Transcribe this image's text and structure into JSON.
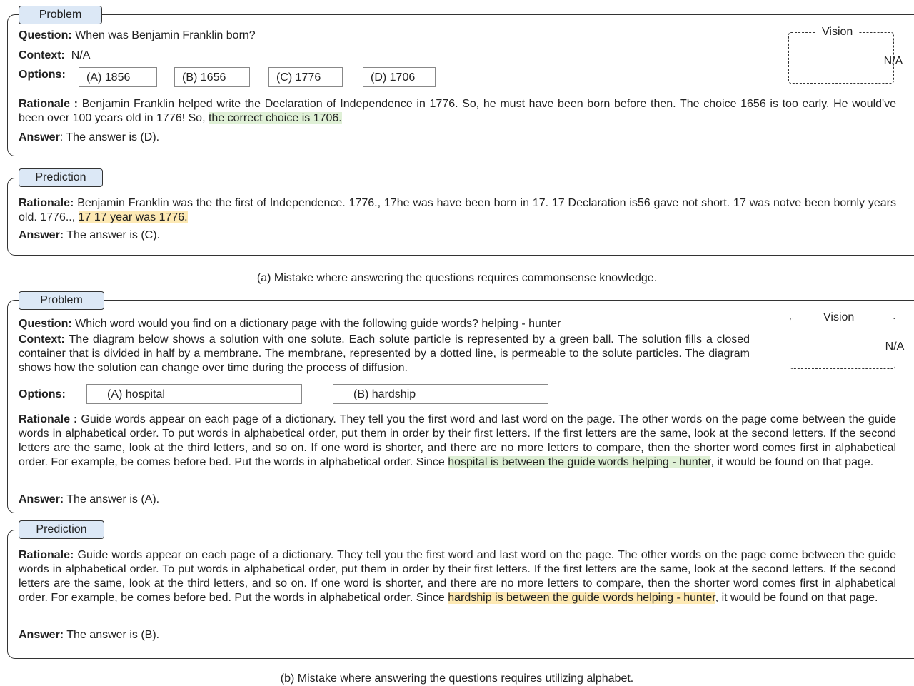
{
  "example_a": {
    "problem_tab": "Problem",
    "question_label": "Question:",
    "question": "When was Benjamin Franklin born?",
    "context_label": "Context:",
    "context": "N/A",
    "options_label": "Options:",
    "options": [
      "(A) 1856",
      "(B) 1656",
      "(C) 1776",
      "(D) 1706"
    ],
    "vision_label": "Vision",
    "vision_value": "N/A",
    "rationale_label": "Rationale :",
    "rationale_text": "Benjamin Franklin helped write the Declaration of Independence in 1776. So, he must have been born before then. The choice 1656 is too early. He would've been over 100 years old in 1776! So,",
    "rationale_highlight": "the correct choice is 1706.",
    "answer_label": "Answer",
    "answer": ":  The answer is (D).",
    "prediction_tab": "Prediction",
    "pred_rationale_label": "Rationale:",
    "pred_rationale_text": "Benjamin Franklin was the the first of Independence. 1776., 17he was have been born in 17. 17 Declaration is56 gave not short. 17 was notve been bornly years old. 1776..,",
    "pred_rationale_highlight": "17 17 year was 1776.",
    "pred_answer_label": "Answer:",
    "pred_answer": "The answer is (C).",
    "caption": "(a) Mistake where answering the questions requires commonsense knowledge."
  },
  "example_b": {
    "problem_tab": "Problem",
    "question_label": "Question:",
    "question": "Which word would you find on a dictionary page with the following guide words? helping - hunter",
    "context_label": "Context:",
    "context": "The diagram below shows a solution with one solute. Each solute particle is represented by a green ball. The solution fills a closed container that is divided in half by a membrane. The membrane, represented by a dotted line, is permeable to the solute particles. The diagram shows how the solution can change over time during the process of diffusion.",
    "options_label": "Options:",
    "options": [
      "(A) hospital",
      "(B) hardship"
    ],
    "vision_label": "Vision",
    "vision_value": "N/A",
    "rationale_label": "Rationale :",
    "rationale_text": "Guide words appear on each page of a dictionary. They tell you the first word and last word on the page. The other words on the page come between the guide words in alphabetical order. To put words in alphabetical order, put them in order by their first letters. If the first letters are the same, look at the second letters. If the second letters are the same, look at the third letters, and so on. If one word is shorter, and there are no more letters to compare, then the shorter word comes first in alphabetical order. For example, be comes before bed. Put the words in alphabetical order. Since",
    "rationale_highlight": "hospital is between the guide words helping - hunter",
    "rationale_tail": ", it would be found on that page.",
    "answer_label": "Answer:",
    "answer": "The answer is (A).",
    "prediction_tab": "Prediction",
    "pred_rationale_label": "Rationale:",
    "pred_rationale_text": "Guide words appear on each page of a dictionary. They tell you the first word and last word on the page. The other words on the page come between the guide words in alphabetical order. To put words in alphabetical order, put them in order by their first letters. If the first letters are the same, look at the second letters. If the second letters are the same, look at the third letters, and so on. If one word is shorter, and there are no more letters to compare, then the shorter word comes first in alphabetical order. For example, be comes before bed. Put the words in alphabetical order. Since",
    "pred_rationale_highlight": "hardship is between the guide words helping - hunter",
    "pred_rationale_tail": ", it would be found on that page.",
    "pred_answer_label": "Answer:",
    "pred_answer": "The answer is (B).",
    "caption": "(b) Mistake where answering the questions requires utilizing alphabet."
  }
}
